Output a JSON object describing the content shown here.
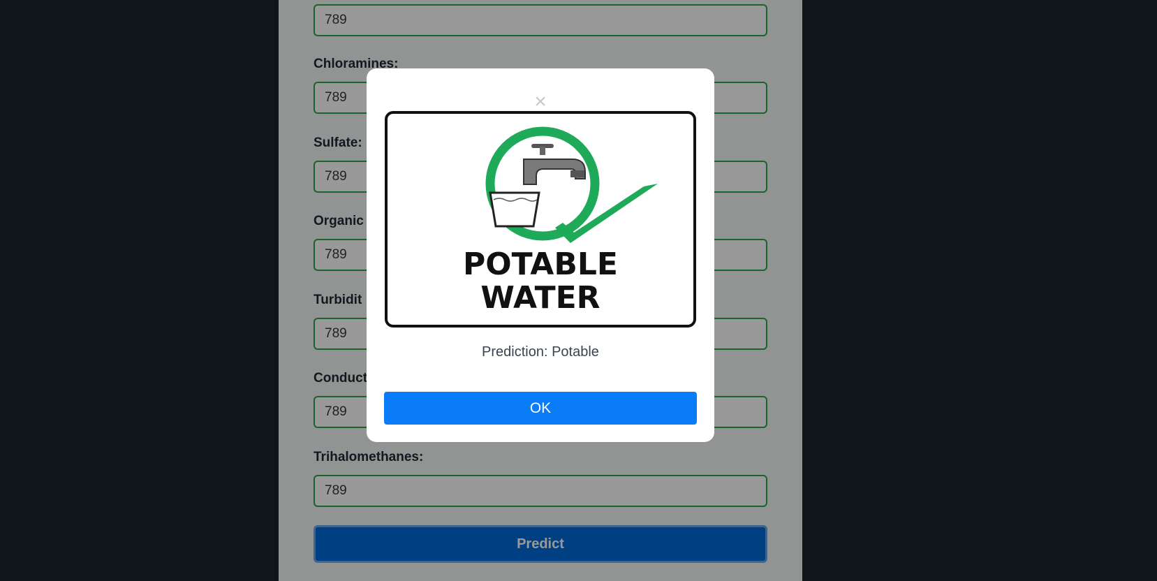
{
  "form": {
    "fields": [
      {
        "label": "",
        "value": "789"
      },
      {
        "label": "Chloramines:",
        "value": "789"
      },
      {
        "label": "Sulfate:",
        "value": "789"
      },
      {
        "label": "Organic",
        "value": "789"
      },
      {
        "label": "Turbidit",
        "value": "789"
      },
      {
        "label": "Conduct",
        "value": "789"
      },
      {
        "label": "Trihalomethanes:",
        "value": "789"
      }
    ],
    "predict_label": "Predict"
  },
  "modal": {
    "close_symbol": "×",
    "sign": {
      "line1": "POTABLE",
      "line2": "WATER",
      "icon": "tap-and-glass-with-checkmark"
    },
    "prediction_text": "Prediction: Potable",
    "ok_label": "OK"
  },
  "colors": {
    "field_border": "#28a745",
    "predict_button": "#0069d9",
    "ok_button": "#0a7cf8",
    "sign_green": "#1faa5a"
  }
}
